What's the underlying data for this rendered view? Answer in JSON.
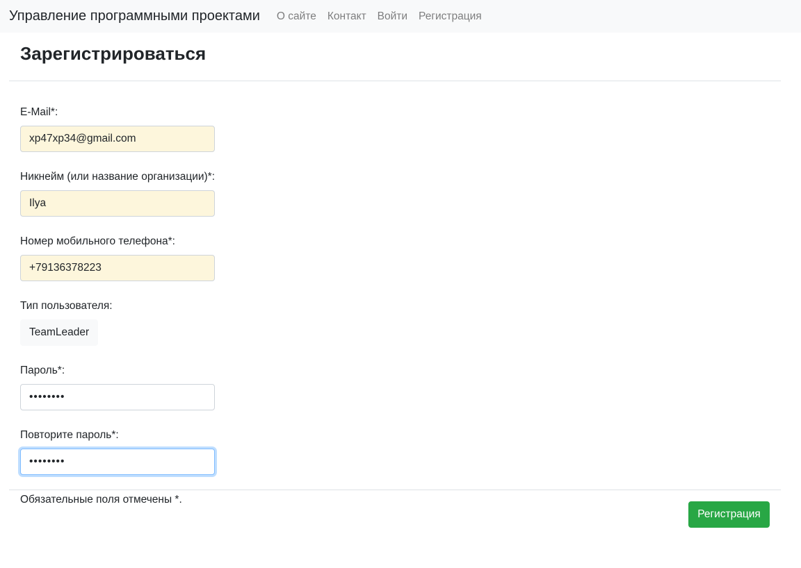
{
  "nav": {
    "brand": "Управление программными проектами",
    "links": [
      "О сайте",
      "Контакт",
      "Войти",
      "Регистрация"
    ]
  },
  "page": {
    "title": "Зарегистрироваться"
  },
  "form": {
    "email": {
      "label": "E-Mail*:",
      "value": "xp47xp34@gmail.com"
    },
    "nickname": {
      "label": "Никнейм (или название организации)*:",
      "value": "Ilya"
    },
    "phone": {
      "label": "Номер мобильного телефона*:",
      "value": "+79136378223"
    },
    "user_type": {
      "label": "Тип пользователя:",
      "value": "TeamLeader"
    },
    "password": {
      "label": "Пароль*:",
      "value": "12345678"
    },
    "password_repeat": {
      "label": "Повторите пароль*:",
      "value": "12345678"
    },
    "required_note": "Обязательные поля отмечены *."
  },
  "footer": {
    "submit_label": "Регистрация"
  },
  "colors": {
    "navbar_bg": "#f8f9fa",
    "autofill_bg": "#fdf6dc",
    "submit_green": "#28a745",
    "focus_border": "#80bdff"
  }
}
